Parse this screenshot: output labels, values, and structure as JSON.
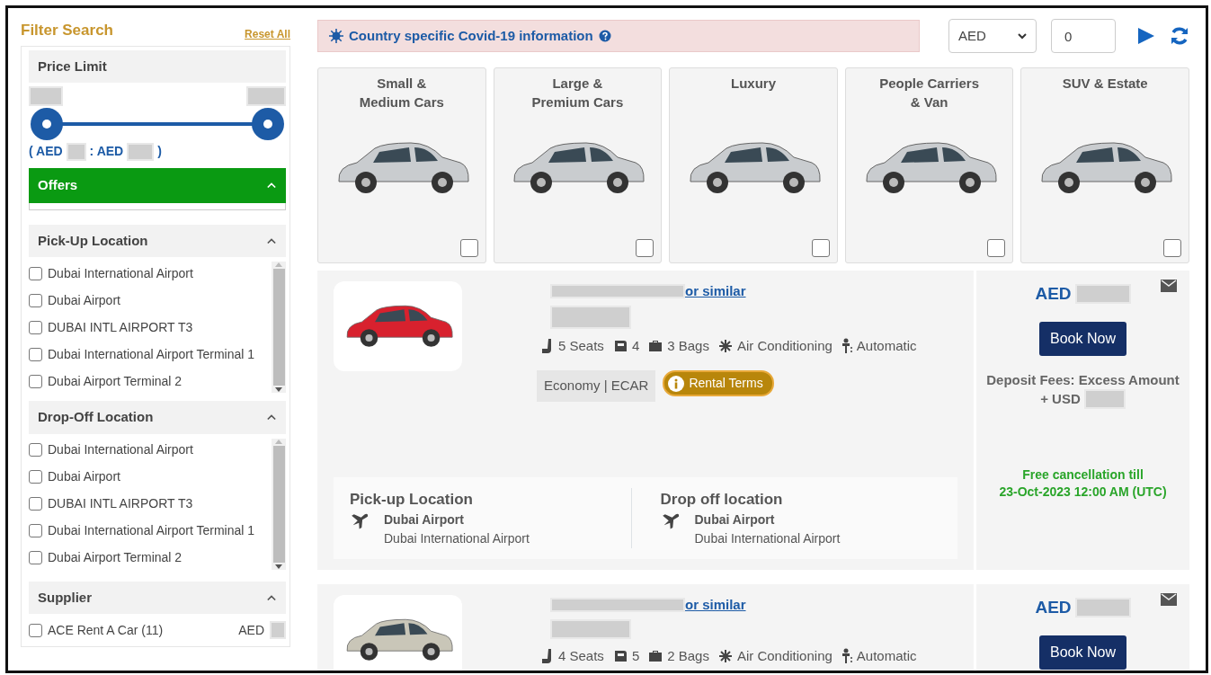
{
  "sidebar": {
    "title": "Filter Search",
    "reset": "Reset All",
    "price": {
      "heading": "Price Limit",
      "low": {
        "level": 0
      },
      "high": {
        "level": 1
      },
      "label_open": "( AED",
      "label_mid": ": AED",
      "label_close": ")"
    },
    "offers": {
      "heading": "Offers",
      "expanded": true
    },
    "sections": [
      {
        "heading": "Pick-Up Location",
        "expanded": true,
        "scrollable": true,
        "options": [
          {
            "label": "Dubai International Airport",
            "checked": false
          },
          {
            "label": "Dubai Airport",
            "checked": false
          },
          {
            "label": "DUBAI INTL AIRPORT T3",
            "checked": false
          },
          {
            "label": "Dubai International Airport Terminal 1",
            "checked": false
          },
          {
            "label": "Dubai Airport Terminal 2",
            "checked": false
          }
        ]
      },
      {
        "heading": "Drop-Off Location",
        "expanded": true,
        "scrollable": true,
        "options": [
          {
            "label": "Dubai International Airport",
            "checked": false
          },
          {
            "label": "Dubai Airport",
            "checked": false
          },
          {
            "label": "DUBAI INTL AIRPORT T3",
            "checked": false
          },
          {
            "label": "Dubai International Airport Terminal 1",
            "checked": false
          },
          {
            "label": "Dubai Airport Terminal 2",
            "checked": false
          }
        ]
      },
      {
        "heading": "Supplier",
        "expanded": true,
        "scrollable": false,
        "options": [
          {
            "label": "ACE Rent A Car (11)",
            "price_prefix": "AED",
            "checked": false
          }
        ]
      }
    ]
  },
  "topbar": {
    "covid": "Country specific Covid-19 information",
    "currency": "AED",
    "amount": "0"
  },
  "categories": [
    {
      "lines": [
        "Small &",
        "Medium Cars"
      ],
      "checked": false
    },
    {
      "lines": [
        "Large &",
        "Premium Cars"
      ],
      "checked": false
    },
    {
      "lines": [
        "Luxury"
      ],
      "checked": false
    },
    {
      "lines": [
        "People Carriers",
        "& Van"
      ],
      "checked": false
    },
    {
      "lines": [
        "SUV & Estate"
      ],
      "checked": false
    }
  ],
  "results": [
    {
      "or_similar": "or similar",
      "features": [
        {
          "kind": "seats",
          "text": "5 Seats"
        },
        {
          "kind": "doors",
          "text": "4"
        },
        {
          "kind": "bags",
          "text": "3 Bags"
        },
        {
          "kind": "ac",
          "text": "Air Conditioning"
        },
        {
          "kind": "transmission",
          "text": "Automatic"
        }
      ],
      "category": "Economy | ECAR",
      "terms": "Rental Terms",
      "pickup": {
        "heading": "Pick-up Location",
        "name": "Dubai Airport",
        "detail": "Dubai International Airport"
      },
      "dropoff": {
        "heading": "Drop off location",
        "name": "Dubai Airport",
        "detail": "Dubai International Airport"
      },
      "price_prefix": "AED",
      "book": "Book Now",
      "deposit": [
        "Deposit Fees: Excess Amount",
        "+ USD"
      ],
      "cancellation": [
        "Free cancellation till",
        "23-Oct-2023 12:00 AM (UTC)"
      ]
    },
    {
      "or_similar": "or similar",
      "features": [
        {
          "kind": "seats",
          "text": "4 Seats"
        },
        {
          "kind": "doors",
          "text": "5"
        },
        {
          "kind": "bags",
          "text": "2 Bags"
        },
        {
          "kind": "ac",
          "text": "Air Conditioning"
        },
        {
          "kind": "transmission",
          "text": "Automatic"
        }
      ],
      "price_prefix": "AED",
      "book": "Book Now"
    }
  ]
}
